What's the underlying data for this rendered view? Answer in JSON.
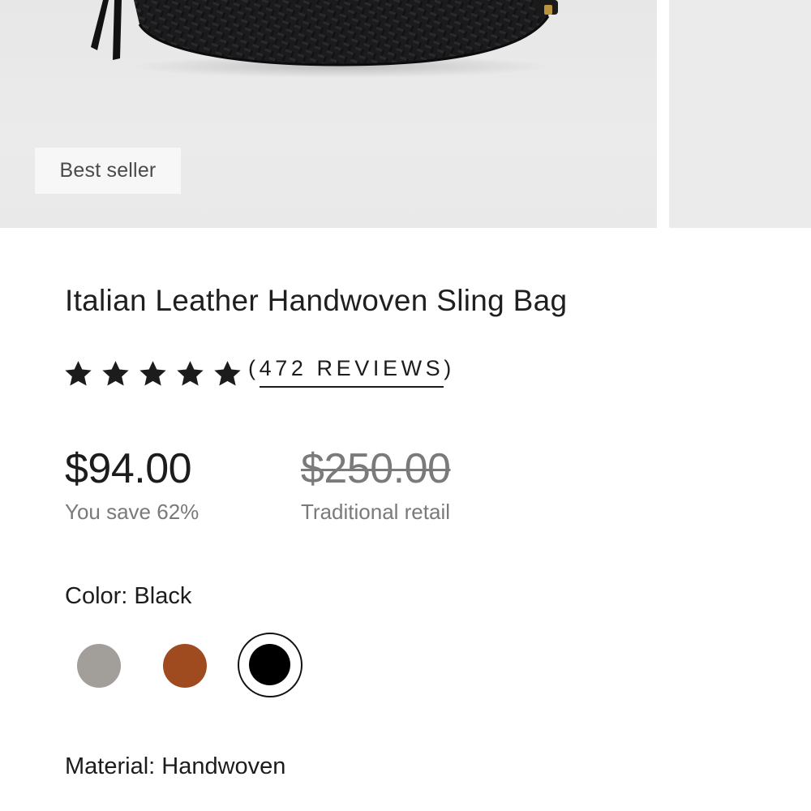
{
  "gallery": {
    "badge": "Best seller"
  },
  "product": {
    "title": "Italian Leather Handwoven Sling Bag",
    "rating": 5,
    "reviews_label": "472 REVIEWS",
    "price": "$94.00",
    "savings": "You save 62%",
    "retail_price": "$250.00",
    "retail_label": "Traditional retail"
  },
  "options": {
    "color_label": "Color: Black",
    "colors": [
      {
        "name": "Grey",
        "hex": "#a29e99",
        "selected": false
      },
      {
        "name": "Cognac",
        "hex": "#a04a20",
        "selected": false
      },
      {
        "name": "Black",
        "hex": "#000000",
        "selected": true
      }
    ],
    "material_label": "Material: Handwoven"
  }
}
